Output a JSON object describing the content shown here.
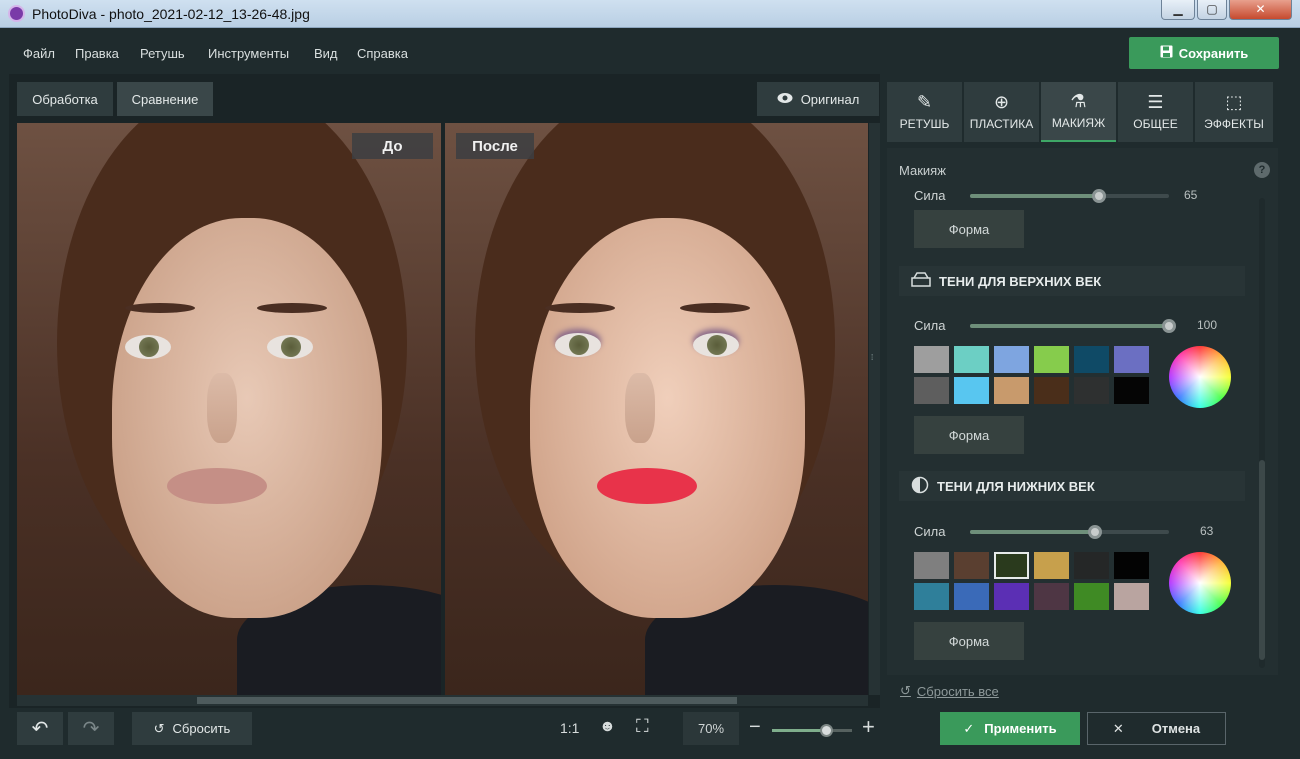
{
  "window": {
    "title": "PhotoDiva - photo_2021-02-12_13-26-48.jpg",
    "min": "▁",
    "max": "▢",
    "close": "✕"
  },
  "menu": {
    "items": [
      "Файл",
      "Правка",
      "Ретушь",
      "Инструменты",
      "Вид",
      "Справка"
    ],
    "save_label": "Сохранить"
  },
  "toolbar": {
    "obrabotka": "Обработка",
    "sravnenie": "Сравнение",
    "original": "Оригинал"
  },
  "photos": {
    "before_label": "До",
    "after_label": "После"
  },
  "bottom": {
    "reset": "Сбросить",
    "zoom_one": "1:1",
    "zoom_value": "70%",
    "zoom_level": 0.68
  },
  "tabs": [
    {
      "label": "РЕТУШЬ",
      "icon": "retouch-icon"
    },
    {
      "label": "ПЛАСТИКА",
      "icon": "plastic-icon"
    },
    {
      "label": "МАКИЯЖ",
      "icon": "makeup-icon"
    },
    {
      "label": "ОБЩЕЕ",
      "icon": "sliders-icon"
    },
    {
      "label": "ЭФФЕКТЫ",
      "icon": "effects-icon"
    }
  ],
  "panel": {
    "title": "Макияж",
    "top_sila": {
      "label": "Сила",
      "value": "65",
      "level": 0.65
    },
    "forma": "Форма",
    "upper": {
      "title": "ТЕНИ ДЛЯ ВЕРХНИХ ВЕК",
      "sila_label": "Сила",
      "value": "100",
      "level": 1.0,
      "swatches": [
        "#9e9e9e",
        "#6ccfc4",
        "#7ea5e0",
        "#86cc4c",
        "#0f4a66",
        "#6b6fc2",
        "#5e5e5e",
        "#58c6f0",
        "#c89a6c",
        "#4a2e1a",
        "#2e3030",
        "#050505"
      ]
    },
    "lower": {
      "title": "ТЕНИ ДЛЯ НИЖНИХ ВЕК",
      "sila_label": "Сила",
      "value": "63",
      "level": 0.63,
      "swatches": [
        "#7f7f7f",
        "#5a3f30",
        "#2a3a1d",
        "#c7a04c",
        "#252727",
        "#030303",
        "#2f7f9a",
        "#3a6ab8",
        "#5b2fb4",
        "#4e3644",
        "#3f8a24",
        "#b9a4a0"
      ],
      "selected_index": 2
    },
    "reset_all": "Сбросить все"
  },
  "actions": {
    "apply": "Применить",
    "cancel": "Отмена"
  },
  "colors": {
    "accent": "#3a9a5b",
    "bg": "#1f2b2d",
    "panel": "#232f31",
    "lips_after": "#e8334a"
  }
}
